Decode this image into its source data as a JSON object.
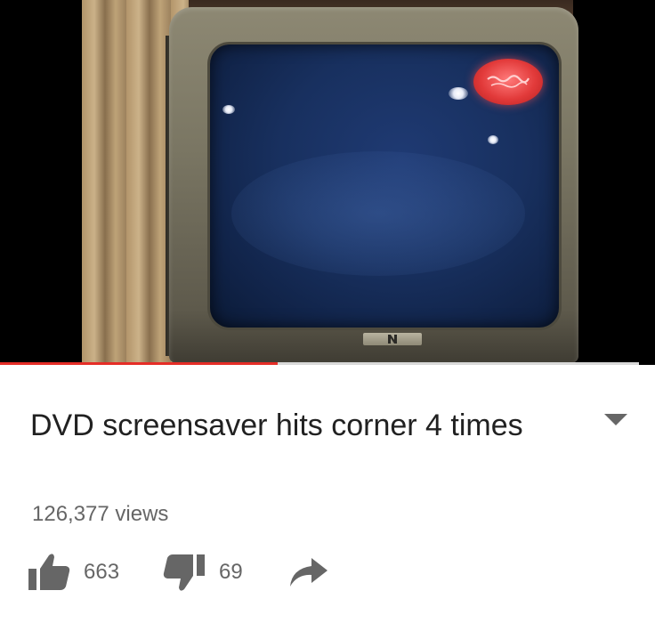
{
  "video": {
    "progress_fraction": 0.435,
    "progress_color": "#e52d27",
    "track_color": "#d9d9d9"
  },
  "details": {
    "title": "DVD screensaver hits corner 4 times",
    "views": "126,377 views",
    "expand_icon": "chevron-down-icon"
  },
  "actions": {
    "like_icon": "thumbs-up-icon",
    "like_count": "663",
    "dislike_icon": "thumbs-down-icon",
    "dislike_count": "69",
    "share_icon": "share-arrow-icon",
    "icon_color": "#666666"
  }
}
